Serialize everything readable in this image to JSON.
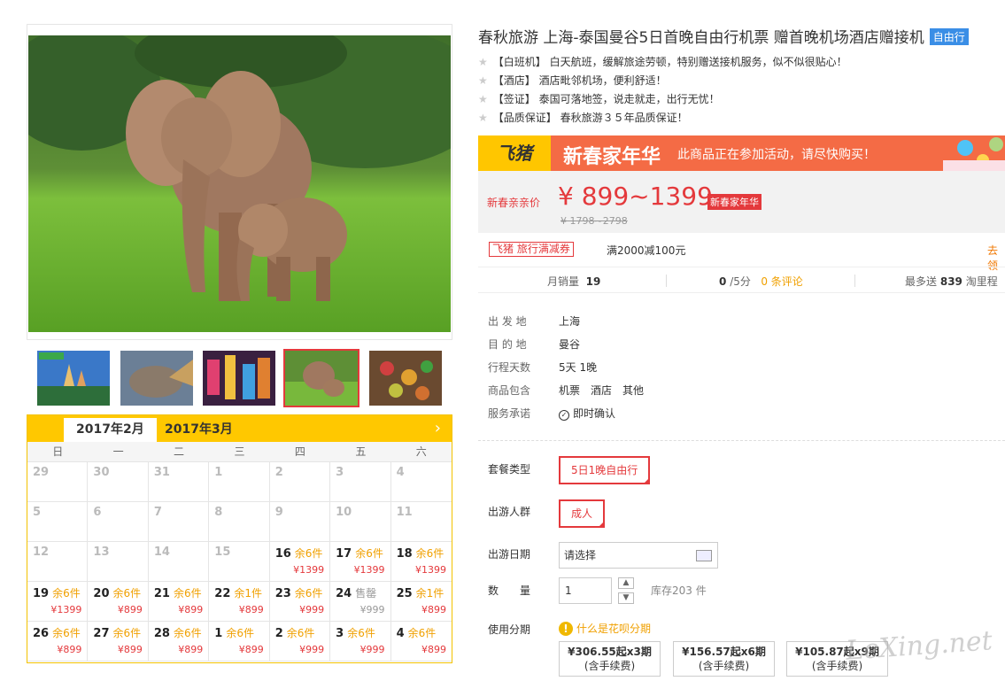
{
  "title": "春秋旅游 上海-泰国曼谷5日首晚自由行机票 赠首晚机场酒店赠接机",
  "title_tag": "自由行",
  "features": [
    "【白班机】 白天航班，缓解旅途劳顿，特别赠送接机服务，似不似很贴心！",
    "【酒店】 酒店毗邻机场，便利舒适！",
    "【签证】 泰国可落地签，说走就走，出行无忧！",
    "【品质保证】 春秋旅游３５年品质保证！"
  ],
  "banner": {
    "logo": "飞猪",
    "title": "新春家年华",
    "subtitle": "此商品正在参加活动，请尽快购买！"
  },
  "price": {
    "label": "新春亲亲价",
    "main": "¥ 899~1399",
    "badge": "新春家年华",
    "old": "¥ 1798~2798"
  },
  "promo": {
    "tag": "飞猪 旅行满减券",
    "text": "满2000减100元",
    "link": "去领"
  },
  "stats": {
    "sales_label": "月销量",
    "sales": "19",
    "rating": "0",
    "rating_suffix": "/5分",
    "reviews": "0 条评论",
    "points_label": "最多送",
    "points": "839",
    "points_suffix": "淘里程"
  },
  "info": [
    {
      "k": "出 发 地",
      "v": "上海"
    },
    {
      "k": "目 的 地",
      "v": "曼谷"
    },
    {
      "k": "行程天数",
      "v": "5天 1晚"
    },
    {
      "k": "商品包含",
      "v": "机票　酒店　其他"
    },
    {
      "k": "服务承诺",
      "v": "即时确认"
    }
  ],
  "options": {
    "package_label": "套餐类型",
    "package_value": "5日1晚自由行",
    "people_label": "出游人群",
    "people_value": "成人",
    "date_label": "出游日期",
    "date_placeholder": "请选择",
    "qty_label": "数　　量",
    "qty_value": "1",
    "stock": "库存203 件",
    "installment_label": "使用分期",
    "installment_q": "什么是花呗分期"
  },
  "installments": [
    {
      "amount": "¥306.55起x3期",
      "note": "(含手续费)"
    },
    {
      "amount": "¥156.57起x6期",
      "note": "(含手续费)"
    },
    {
      "amount": "¥105.87起x9期",
      "note": "(含手续费)"
    }
  ],
  "calendar": {
    "tabs": [
      "2017年2月",
      "2017年3月"
    ],
    "weekdays": [
      "日",
      "一",
      "二",
      "三",
      "四",
      "五",
      "六"
    ],
    "days": [
      {
        "n": "29",
        "past": true
      },
      {
        "n": "30",
        "past": true
      },
      {
        "n": "31",
        "past": true
      },
      {
        "n": "1",
        "past": true
      },
      {
        "n": "2",
        "past": true
      },
      {
        "n": "3",
        "past": true
      },
      {
        "n": "4",
        "past": true
      },
      {
        "n": "5",
        "past": true
      },
      {
        "n": "6",
        "past": true
      },
      {
        "n": "7",
        "past": true
      },
      {
        "n": "8",
        "past": true
      },
      {
        "n": "9",
        "past": true
      },
      {
        "n": "10",
        "past": true
      },
      {
        "n": "11",
        "past": true
      },
      {
        "n": "12",
        "past": true
      },
      {
        "n": "13",
        "past": true
      },
      {
        "n": "14",
        "past": true
      },
      {
        "n": "15",
        "past": true
      },
      {
        "n": "16",
        "s": "余6件",
        "p": "¥1399"
      },
      {
        "n": "17",
        "s": "余6件",
        "p": "¥1399"
      },
      {
        "n": "18",
        "s": "余6件",
        "p": "¥1399"
      },
      {
        "n": "19",
        "s": "余6件",
        "p": "¥1399"
      },
      {
        "n": "20",
        "s": "余6件",
        "p": "¥899"
      },
      {
        "n": "21",
        "s": "余6件",
        "p": "¥899"
      },
      {
        "n": "22",
        "s": "余1件",
        "p": "¥899"
      },
      {
        "n": "23",
        "s": "余6件",
        "p": "¥999"
      },
      {
        "n": "24",
        "s": "售罄",
        "p": "¥999",
        "sold": true
      },
      {
        "n": "25",
        "s": "余1件",
        "p": "¥899"
      },
      {
        "n": "26",
        "s": "余6件",
        "p": "¥899"
      },
      {
        "n": "27",
        "s": "余6件",
        "p": "¥899"
      },
      {
        "n": "28",
        "s": "余6件",
        "p": "¥899"
      },
      {
        "n": "1",
        "s": "余6件",
        "p": "¥899"
      },
      {
        "n": "2",
        "s": "余6件",
        "p": "¥999"
      },
      {
        "n": "3",
        "s": "余6件",
        "p": "¥999"
      },
      {
        "n": "4",
        "s": "余6件",
        "p": "¥899"
      }
    ]
  },
  "watermark": "LeXing.net"
}
